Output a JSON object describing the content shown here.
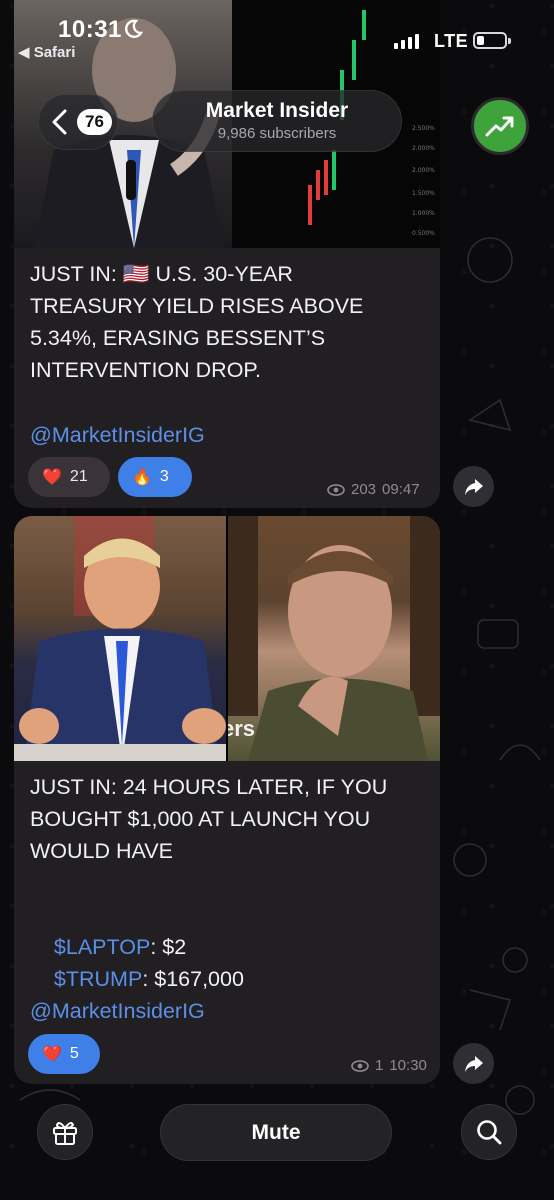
{
  "status_bar": {
    "time": "10:31",
    "back_app": "◀ Safari",
    "network": "LTE",
    "battery_level": 0.25
  },
  "header": {
    "unread_count": "76",
    "channel_name": "Market Insider",
    "subscribers": "9,986 subscribers",
    "avatar_icon": "chart-up-icon",
    "avatar_color": "#3ea33a"
  },
  "messages": [
    {
      "text": "JUST IN: 🇺🇸 U.S. 30-YEAR\nTREASURY YIELD RISES ABOVE\n5.34%, ERASING BESSENT’S\nINTERVENTION DROP.",
      "mention": "@MarketInsiderIG",
      "reactions": [
        {
          "emoji": "❤️",
          "count": "21",
          "mine": false
        },
        {
          "emoji": "🔥",
          "count": "3",
          "mine": true
        }
      ],
      "views": "203",
      "time": "09:47"
    },
    {
      "text_head": "JUST IN: 24 HOURS LATER, IF YOU\nBOUGHT $1,000 AT LAUNCH YOU\nWOULD HAVE",
      "lines": [
        {
          "ticker": "$LAPTOP",
          "value": ": $2"
        },
        {
          "ticker": "$TRUMP",
          "value": ": $167,000"
        }
      ],
      "image_overlay_text": "ers",
      "mention": "@MarketInsiderIG",
      "reactions": [
        {
          "emoji": "❤️",
          "count": "5",
          "mine": true
        }
      ],
      "views": "1",
      "time": "10:30"
    }
  ],
  "bottom_bar": {
    "gift_icon": "gift-icon",
    "mute_label": "Mute",
    "search_icon": "search-icon"
  },
  "colors": {
    "accent": "#3f7fe8",
    "link": "#5b8fe8",
    "bubble": "#221f23"
  }
}
